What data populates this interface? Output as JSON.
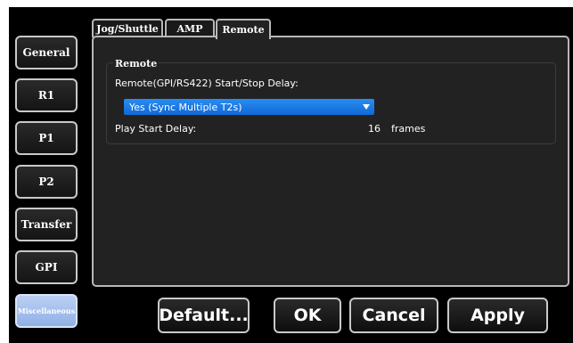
{
  "tabs": [
    {
      "label": "Jog/Shuttle"
    },
    {
      "label": "AMP"
    },
    {
      "label": "Remote",
      "active": true
    }
  ],
  "sidebar": {
    "items": [
      {
        "label": "General"
      },
      {
        "label": "R1"
      },
      {
        "label": "P1"
      },
      {
        "label": "P2"
      },
      {
        "label": "Transfer"
      },
      {
        "label": "GPI"
      },
      {
        "label": "Miscellaneous",
        "selected": true
      }
    ]
  },
  "remote": {
    "group_title": "Remote",
    "delay_label": "Remote(GPI/RS422) Start/Stop Delay:",
    "delay_value": "Yes (Sync Multiple T2s)",
    "play_start_label": "Play Start Delay:",
    "play_start_value": "16",
    "play_start_unit": "frames"
  },
  "actions": {
    "default_label": "Default...",
    "ok_label": "OK",
    "cancel_label": "Cancel",
    "apply_label": "Apply"
  },
  "colors": {
    "accent": "#1a7ae6",
    "selected": "#9db9ea",
    "background": "#000000",
    "panel": "#222222"
  }
}
